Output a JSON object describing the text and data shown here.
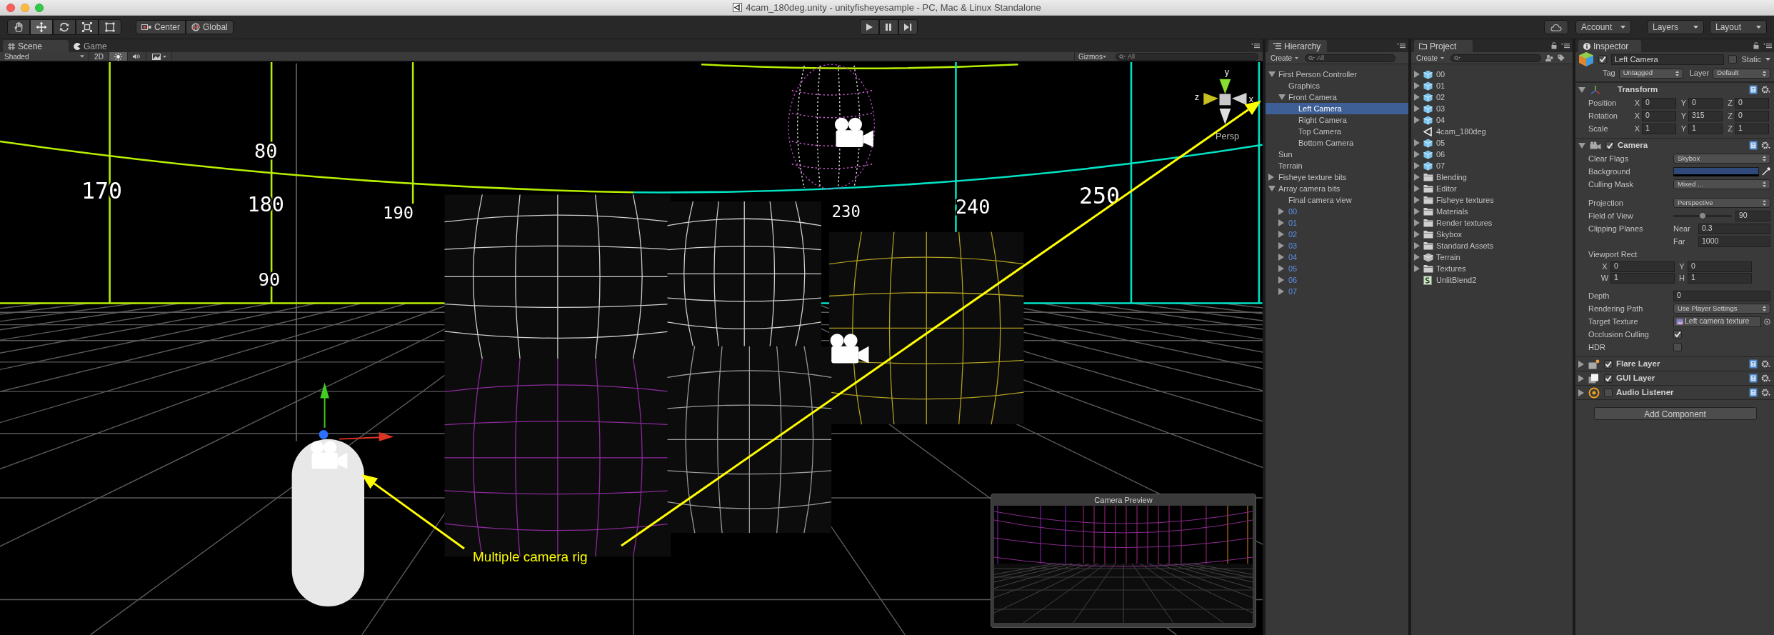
{
  "window": {
    "title": "4cam_180deg.unity - unityfisheyesample - PC, Mac & Linux Standalone"
  },
  "toolbar": {
    "tools": [
      {
        "kind": "hand",
        "selected": false
      },
      {
        "kind": "move",
        "selected": true
      },
      {
        "kind": "rotate",
        "selected": false
      },
      {
        "kind": "scale",
        "selected": false
      },
      {
        "kind": "rect",
        "selected": false
      }
    ],
    "pivot_buttons": [
      {
        "kind": "pivot",
        "label": "Center"
      },
      {
        "kind": "globe",
        "label": "Global"
      }
    ],
    "menus": [
      "Account",
      "Layers",
      "Layout"
    ]
  },
  "scene_panel": {
    "tabs": [
      {
        "kind": "scene",
        "label": "Scene",
        "selected": true
      },
      {
        "kind": "game",
        "label": "Game",
        "selected": false
      }
    ],
    "draw_mode": "Shaded",
    "mode_2d": "2D",
    "toggles": [
      {
        "kind": "lighting",
        "on": true
      },
      {
        "kind": "audio",
        "on": false
      }
    ],
    "gizmos": "Gizmos",
    "search_placeholder": "All",
    "wall_labels": [
      "170",
      "80",
      "180",
      "90",
      "190",
      "230",
      "240",
      "250"
    ],
    "gizmo": {
      "axes": [
        "y",
        "x",
        "z"
      ],
      "projection": "Persp"
    },
    "annotation": "Multiple camera rig",
    "preview": {
      "title": "Camera Preview"
    }
  },
  "hierarchy": {
    "title": "Hierarchy",
    "create": "Create",
    "search_placeholder": "All",
    "items": [
      {
        "label": "First Person Controller",
        "kind": "object",
        "selected": false,
        "expanded": true,
        "children": [
          {
            "label": "Graphics",
            "kind": "object",
            "selected": false
          },
          {
            "label": "Front Camera",
            "kind": "object",
            "selected": false,
            "expanded": true,
            "children": [
              {
                "label": "Left Camera",
                "kind": "object",
                "selected": true
              },
              {
                "label": "Right Camera",
                "kind": "object",
                "selected": false
              },
              {
                "label": "Top Camera",
                "kind": "object",
                "selected": false
              },
              {
                "label": "Bottom Camera",
                "kind": "object",
                "selected": false
              }
            ]
          }
        ]
      },
      {
        "label": "Sun",
        "kind": "object",
        "selected": false
      },
      {
        "label": "Terrain",
        "kind": "object",
        "selected": false
      },
      {
        "label": "Fisheye texture bits",
        "kind": "object",
        "selected": false,
        "expanded": false
      },
      {
        "label": "Array camera bits",
        "kind": "object",
        "selected": false,
        "expanded": true,
        "children": [
          {
            "label": "Final camera view",
            "kind": "object",
            "selected": false
          },
          {
            "label": "00",
            "kind": "prefab",
            "selected": false,
            "expanded": false
          },
          {
            "label": "01",
            "kind": "prefab",
            "selected": false,
            "expanded": false
          },
          {
            "label": "02",
            "kind": "prefab",
            "selected": false,
            "expanded": false
          },
          {
            "label": "03",
            "kind": "prefab",
            "selected": false,
            "expanded": false
          },
          {
            "label": "04",
            "kind": "prefab",
            "selected": false,
            "expanded": false
          },
          {
            "label": "05",
            "kind": "prefab",
            "selected": false,
            "expanded": false
          },
          {
            "label": "06",
            "kind": "prefab",
            "selected": false,
            "expanded": false
          },
          {
            "label": "07",
            "kind": "prefab",
            "selected": false,
            "expanded": false
          }
        ]
      }
    ]
  },
  "project": {
    "title": "Project",
    "create": "Create",
    "items": [
      {
        "label": "00",
        "kind": "prefab",
        "expanded": false
      },
      {
        "label": "01",
        "kind": "prefab",
        "expanded": false
      },
      {
        "label": "02",
        "kind": "prefab",
        "expanded": false
      },
      {
        "label": "03",
        "kind": "prefab",
        "expanded": false
      },
      {
        "label": "04",
        "kind": "prefab",
        "expanded": false
      },
      {
        "label": "4cam_180deg",
        "kind": "scene"
      },
      {
        "label": "05",
        "kind": "prefab",
        "expanded": false
      },
      {
        "label": "06",
        "kind": "prefab",
        "expanded": false
      },
      {
        "label": "07",
        "kind": "prefab",
        "expanded": false
      },
      {
        "label": "Blending",
        "kind": "folder",
        "expanded": false
      },
      {
        "label": "Editor",
        "kind": "folder",
        "expanded": false
      },
      {
        "label": "Fisheye textures",
        "kind": "folder",
        "expanded": false
      },
      {
        "label": "Materials",
        "kind": "folder",
        "expanded": false
      },
      {
        "label": "Render textures",
        "kind": "folder",
        "expanded": false
      },
      {
        "label": "Skybox",
        "kind": "folder",
        "expanded": false
      },
      {
        "label": "Standard Assets",
        "kind": "folder",
        "expanded": false
      },
      {
        "label": "Terrain",
        "kind": "terrain",
        "expanded": false
      },
      {
        "label": "Textures",
        "kind": "folder",
        "expanded": false
      },
      {
        "label": "UnlitBlend2",
        "kind": "shader"
      }
    ]
  },
  "inspector": {
    "title": "Inspector",
    "object": {
      "active": true,
      "name": "Left Camera",
      "static": false,
      "static_label": "Static",
      "tag_label": "Tag",
      "tag": "Untagged",
      "layer_label": "Layer",
      "layer": "Default"
    },
    "components": [
      {
        "kind": "transform",
        "name": "Transform",
        "expanded": true,
        "rows": [
          {
            "label": "Position",
            "cells": [
              {
                "axis": "X",
                "value": "0"
              },
              {
                "axis": "Y",
                "value": "0"
              },
              {
                "axis": "Z",
                "value": "0"
              }
            ]
          },
          {
            "label": "Rotation",
            "cells": [
              {
                "axis": "X",
                "value": "0"
              },
              {
                "axis": "Y",
                "value": "315"
              },
              {
                "axis": "Z",
                "value": "0"
              }
            ]
          },
          {
            "label": "Scale",
            "cells": [
              {
                "axis": "X",
                "value": "1"
              },
              {
                "axis": "Y",
                "value": "1"
              },
              {
                "axis": "Z",
                "value": "1"
              }
            ]
          }
        ]
      },
      {
        "kind": "camera",
        "name": "Camera",
        "expanded": true,
        "enabled": true,
        "field_groups": [
          [
            {
              "kind": "dropdown",
              "label": "Clear Flags",
              "value": "Skybox"
            },
            {
              "kind": "color",
              "label": "Background",
              "color": "#2f4a7a"
            },
            {
              "kind": "dropdown",
              "label": "Culling Mask",
              "value": "Mixed ..."
            }
          ],
          [
            {
              "kind": "dropdown",
              "label": "Projection",
              "value": "Perspective"
            },
            {
              "kind": "slider",
              "label": "Field of View",
              "level": 0.5,
              "value": "90"
            },
            {
              "kind": "pair",
              "label": "Clipping Planes",
              "rows": [
                {
                  "label": "Near",
                  "value": "0.3"
                },
                {
                  "label": "Far",
                  "value": "1000"
                }
              ]
            },
            {
              "kind": "rect",
              "label": "Viewport Rect",
              "cells": [
                {
                  "label": "X",
                  "value": "0"
                },
                {
                  "label": "Y",
                  "value": "0"
                },
                {
                  "label": "W",
                  "value": "1"
                },
                {
                  "label": "H",
                  "value": "1"
                }
              ]
            }
          ],
          [
            {
              "kind": "text",
              "label": "Depth",
              "value": "0"
            },
            {
              "kind": "dropdown",
              "label": "Rendering Path",
              "value": "Use Player Settings"
            },
            {
              "kind": "object",
              "label": "Target Texture",
              "value": "Left camera texture"
            },
            {
              "kind": "checkbox",
              "label": "Occlusion Culling",
              "checked": true
            },
            {
              "kind": "checkbox",
              "label": "HDR",
              "checked": false
            }
          ]
        ]
      },
      {
        "kind": "flare",
        "name": "Flare Layer",
        "expanded": false,
        "enabled": true
      },
      {
        "kind": "gui",
        "name": "GUI Layer",
        "expanded": false,
        "enabled": true
      },
      {
        "kind": "audio",
        "name": "Audio Listener",
        "expanded": false,
        "enabled": false
      }
    ],
    "add_component": "Add Component"
  }
}
